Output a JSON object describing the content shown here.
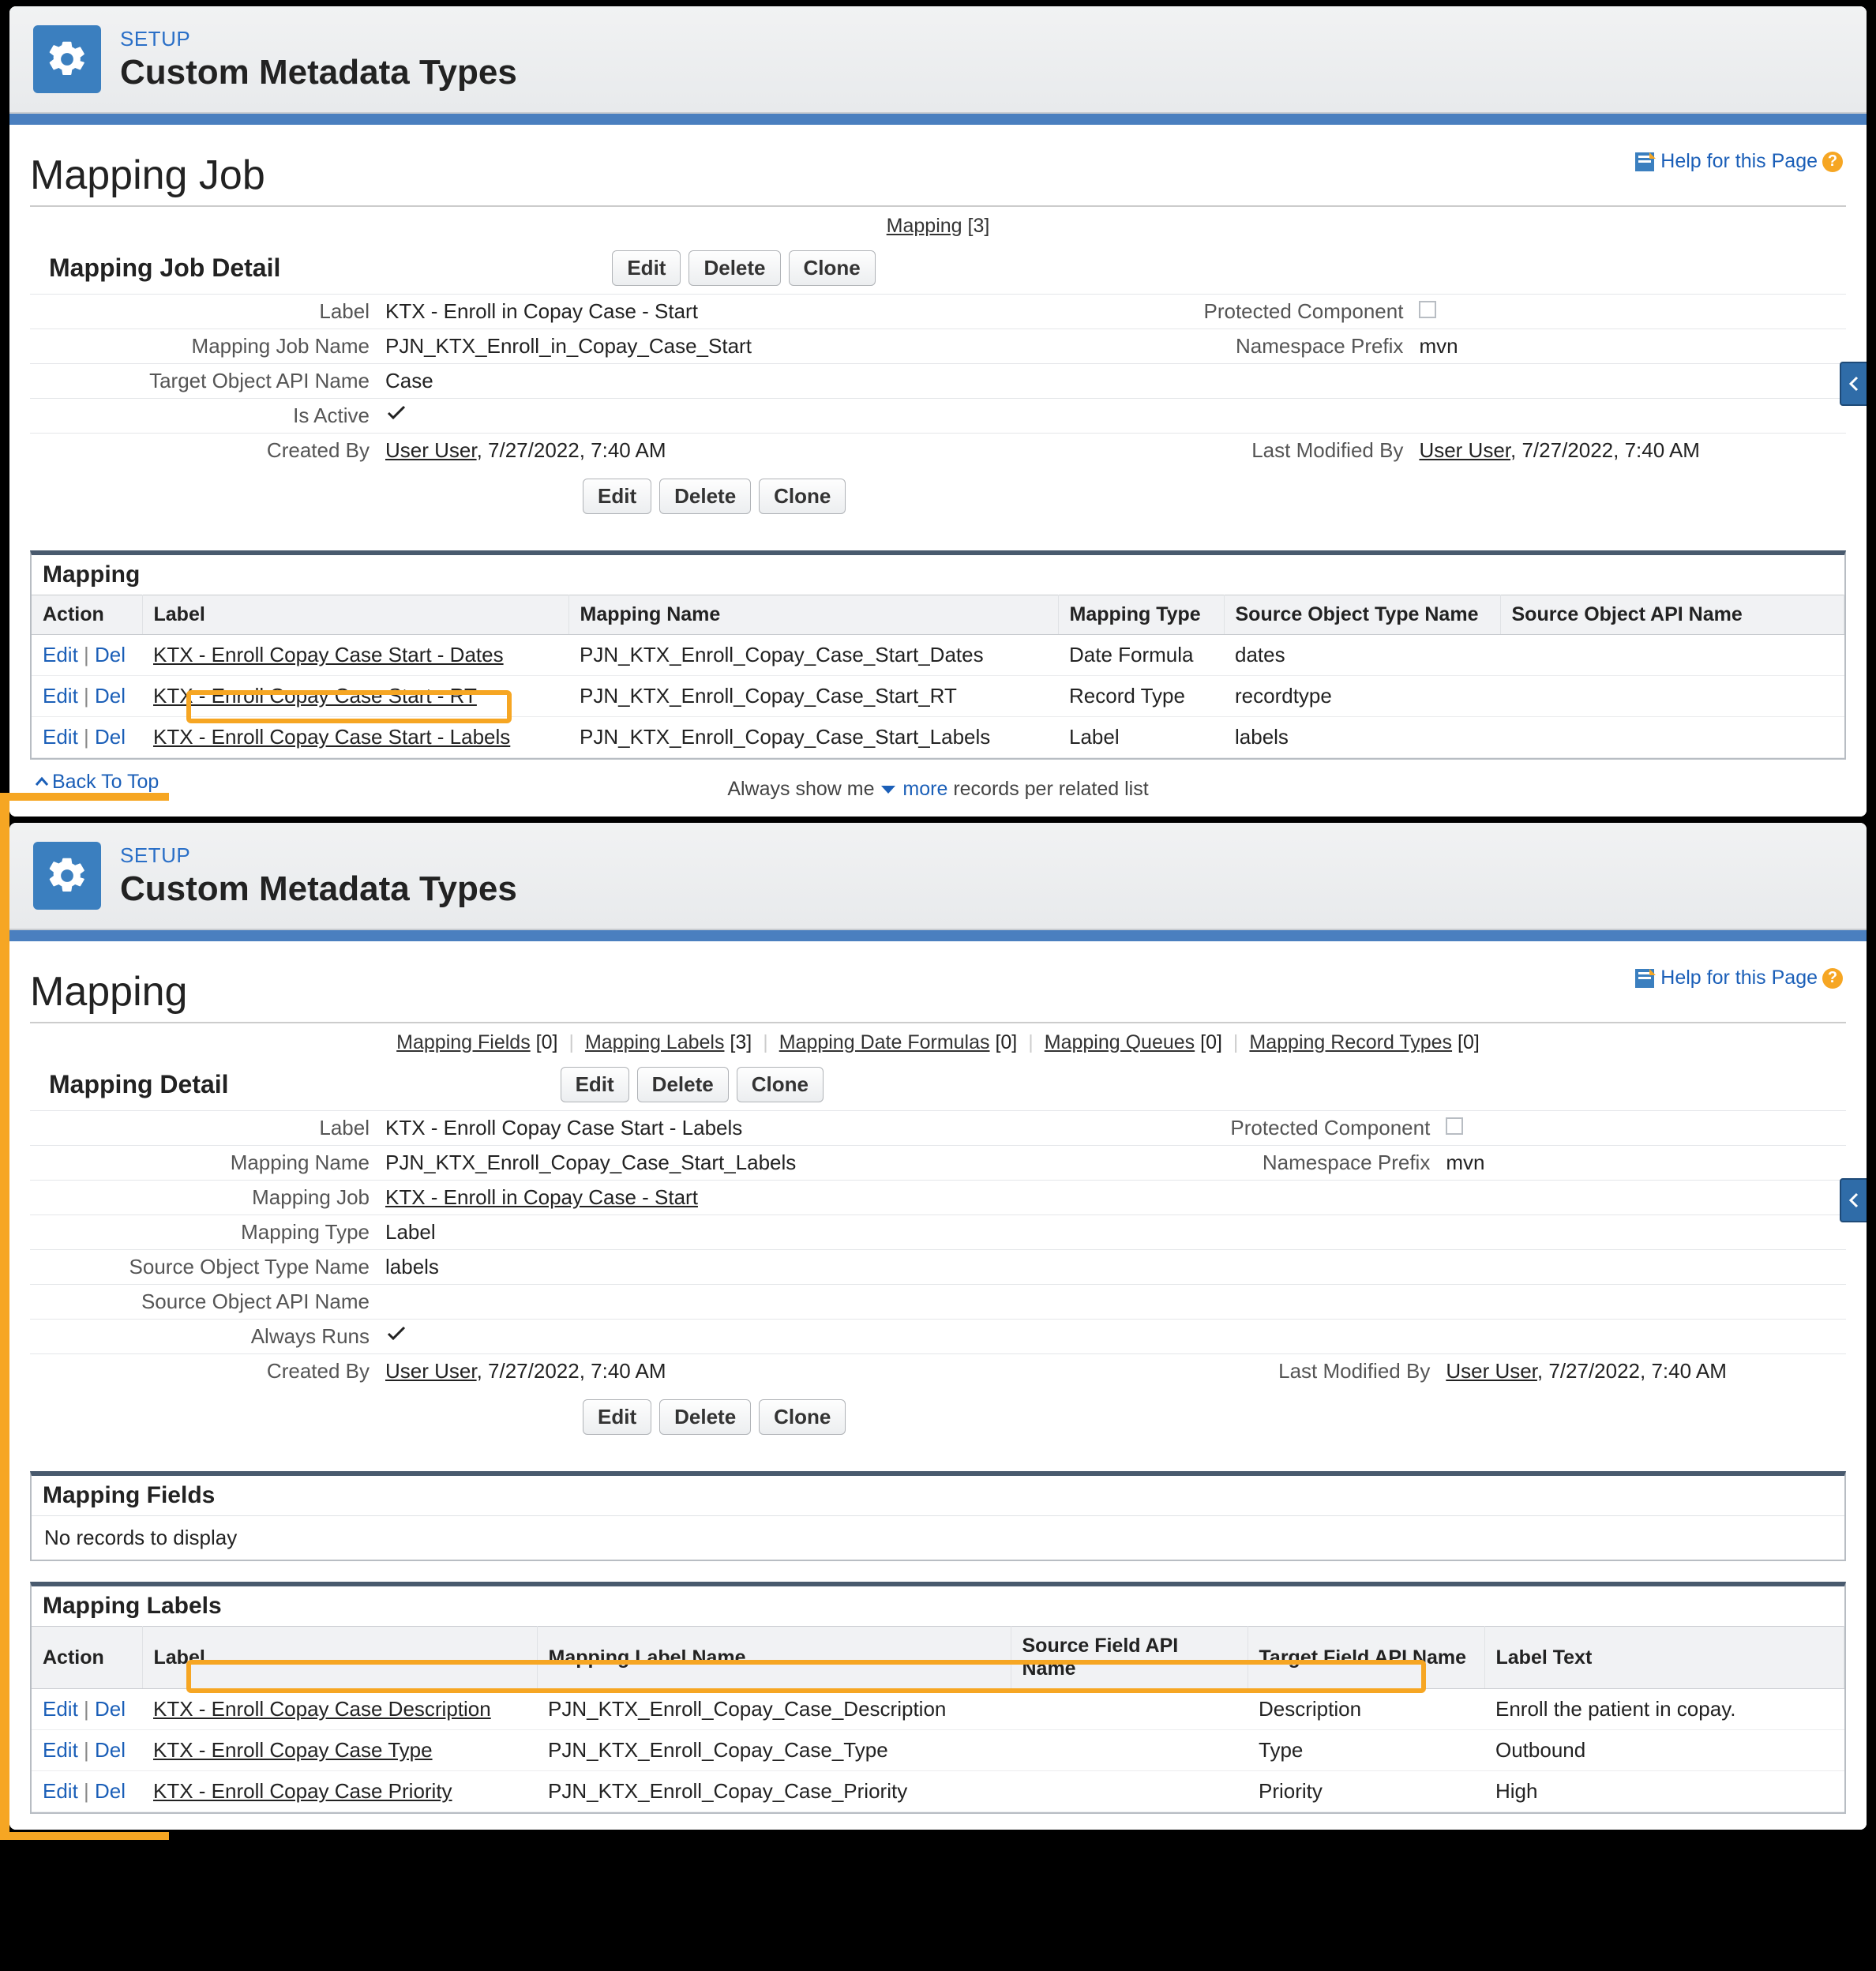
{
  "header": {
    "eyebrow": "SETUP",
    "title": "Custom Metadata Types"
  },
  "help": "Help for this Page",
  "panel1": {
    "page_title": "Mapping Job",
    "anchor": {
      "label": "Mapping",
      "count": "[3]"
    },
    "section": "Mapping Job Detail",
    "buttons": {
      "edit": "Edit",
      "delete": "Delete",
      "clone": "Clone"
    },
    "fields": {
      "label_k": "Label",
      "label_v": "KTX - Enroll in Copay Case - Start",
      "protected_k": "Protected Component",
      "jobname_k": "Mapping Job Name",
      "jobname_v": "PJN_KTX_Enroll_in_Copay_Case_Start",
      "nsprefix_k": "Namespace Prefix",
      "nsprefix_v": "mvn",
      "target_k": "Target Object API Name",
      "target_v": "Case",
      "active_k": "Is Active",
      "created_k": "Created By",
      "created_user": "User User",
      "created_dt": ", 7/27/2022, 7:40 AM",
      "modified_k": "Last Modified By",
      "modified_user": "User User",
      "modified_dt": ", 7/27/2022, 7:40 AM"
    },
    "related": {
      "title": "Mapping",
      "cols": {
        "action": "Action",
        "label": "Label",
        "name": "Mapping Name",
        "type": "Mapping Type",
        "sotype": "Source Object Type Name",
        "soapi": "Source Object API Name"
      },
      "actions": {
        "edit": "Edit",
        "del": "Del",
        "sep": " | "
      },
      "rows": [
        {
          "label": "KTX - Enroll Copay Case Start - Dates",
          "name": "PJN_KTX_Enroll_Copay_Case_Start_Dates",
          "type": "Date Formula",
          "sotype": "dates",
          "soapi": ""
        },
        {
          "label": "KTX - Enroll Copay Case Start - RT",
          "name": "PJN_KTX_Enroll_Copay_Case_Start_RT",
          "type": "Record Type",
          "sotype": "recordtype",
          "soapi": ""
        },
        {
          "label": "KTX - Enroll Copay Case Start - Labels",
          "name": "PJN_KTX_Enroll_Copay_Case_Start_Labels",
          "type": "Label",
          "sotype": "labels",
          "soapi": ""
        }
      ]
    },
    "back": "Back To Top",
    "footer": {
      "a": "Always show me ",
      "b": "more",
      "c": " records per related list"
    }
  },
  "panel2": {
    "page_title": "Mapping",
    "anchors": [
      {
        "label": "Mapping Fields",
        "count": "[0]"
      },
      {
        "label": "Mapping Labels",
        "count": "[3]"
      },
      {
        "label": "Mapping Date Formulas",
        "count": "[0]"
      },
      {
        "label": "Mapping Queues",
        "count": "[0]"
      },
      {
        "label": "Mapping Record Types",
        "count": "[0]"
      }
    ],
    "section": "Mapping Detail",
    "buttons": {
      "edit": "Edit",
      "delete": "Delete",
      "clone": "Clone"
    },
    "fields": {
      "label_k": "Label",
      "label_v": "KTX - Enroll Copay Case Start - Labels",
      "protected_k": "Protected Component",
      "name_k": "Mapping Name",
      "name_v": "PJN_KTX_Enroll_Copay_Case_Start_Labels",
      "nsprefix_k": "Namespace Prefix",
      "nsprefix_v": "mvn",
      "job_k": "Mapping Job",
      "job_v": "KTX - Enroll in Copay Case - Start",
      "type_k": "Mapping Type",
      "type_v": "Label",
      "sotype_k": "Source Object Type Name",
      "sotype_v": "labels",
      "soapi_k": "Source Object API Name",
      "always_k": "Always Runs",
      "created_k": "Created By",
      "created_user": "User User",
      "created_dt": ", 7/27/2022, 7:40 AM",
      "modified_k": "Last Modified By",
      "modified_user": "User User",
      "modified_dt": ", 7/27/2022, 7:40 AM"
    },
    "related1": {
      "title": "Mapping Fields",
      "empty": "No records to display"
    },
    "related2": {
      "title": "Mapping Labels",
      "cols": {
        "action": "Action",
        "label": "Label",
        "name": "Mapping Label Name",
        "src": "Source Field API Name",
        "tgt": "Target Field API Name",
        "text": "Label Text"
      },
      "actions": {
        "edit": "Edit",
        "del": "Del",
        "sep": " | "
      },
      "rows": [
        {
          "label": "KTX - Enroll Copay Case Description",
          "name": "PJN_KTX_Enroll_Copay_Case_Description",
          "src": "",
          "tgt": "Description",
          "text": "Enroll the patient in copay."
        },
        {
          "label": "KTX - Enroll Copay Case Type",
          "name": "PJN_KTX_Enroll_Copay_Case_Type",
          "src": "",
          "tgt": "Type",
          "text": "Outbound"
        },
        {
          "label": "KTX - Enroll Copay Case Priority",
          "name": "PJN_KTX_Enroll_Copay_Case_Priority",
          "src": "",
          "tgt": "Priority",
          "text": "High"
        }
      ]
    }
  }
}
